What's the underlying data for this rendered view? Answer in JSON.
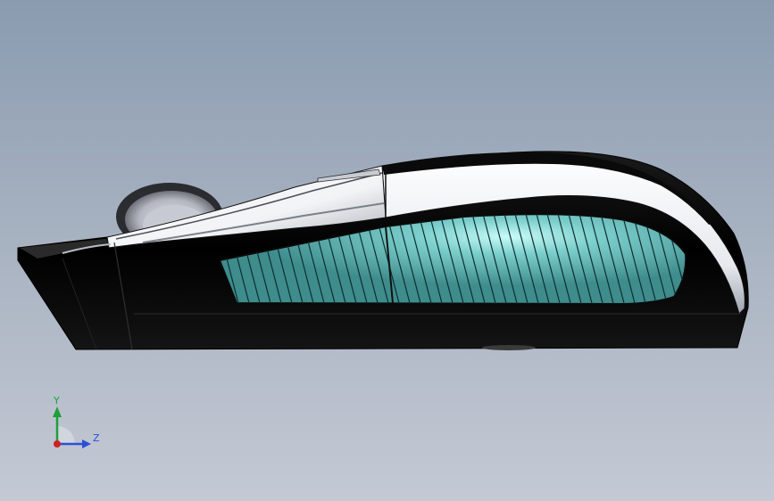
{
  "viewport": {
    "background_top": "#8a9bb0",
    "background_bottom": "#c4c9d4"
  },
  "model": {
    "body_color": "#050505",
    "shell_color": "#ffffff",
    "grille_color": "#3e8c8c",
    "grille_highlight": "#bff4f2",
    "wheel_color": "#b9bcc6"
  },
  "triad": {
    "y_label": "Y",
    "z_label": "Z",
    "y_color": "#1f9e3a",
    "z_color": "#2c4fd6",
    "x_color": "#d02020"
  }
}
